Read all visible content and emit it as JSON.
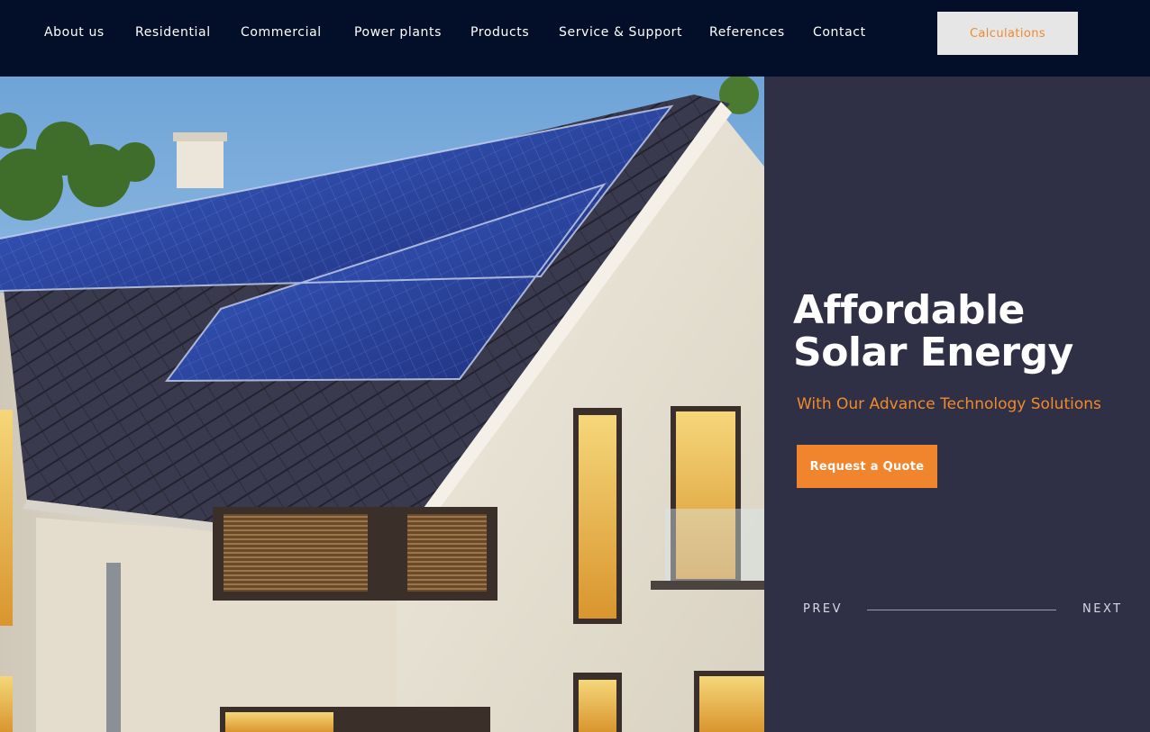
{
  "nav": {
    "items": [
      {
        "label": "About us"
      },
      {
        "label": "Residential"
      },
      {
        "label": "Commercial"
      },
      {
        "label": "Power plants"
      },
      {
        "label": "Products"
      },
      {
        "label": "Service & Support"
      },
      {
        "label": "References"
      },
      {
        "label": "Contact"
      }
    ],
    "cta_label": "Calculations"
  },
  "hero": {
    "image_alt": "",
    "headline_line1": "Affordable",
    "headline_line2": "Solar Energy",
    "subheadline": "With Our Advance Technology Solutions",
    "cta_label": "Request a Quote",
    "prev_label": "PREV",
    "next_label": "NEXT"
  },
  "colors": {
    "nav_bg": "#030e29",
    "panel_bg": "#2f3045",
    "accent": "#f0852d",
    "calc_btn_bg": "#e6e6e6"
  }
}
